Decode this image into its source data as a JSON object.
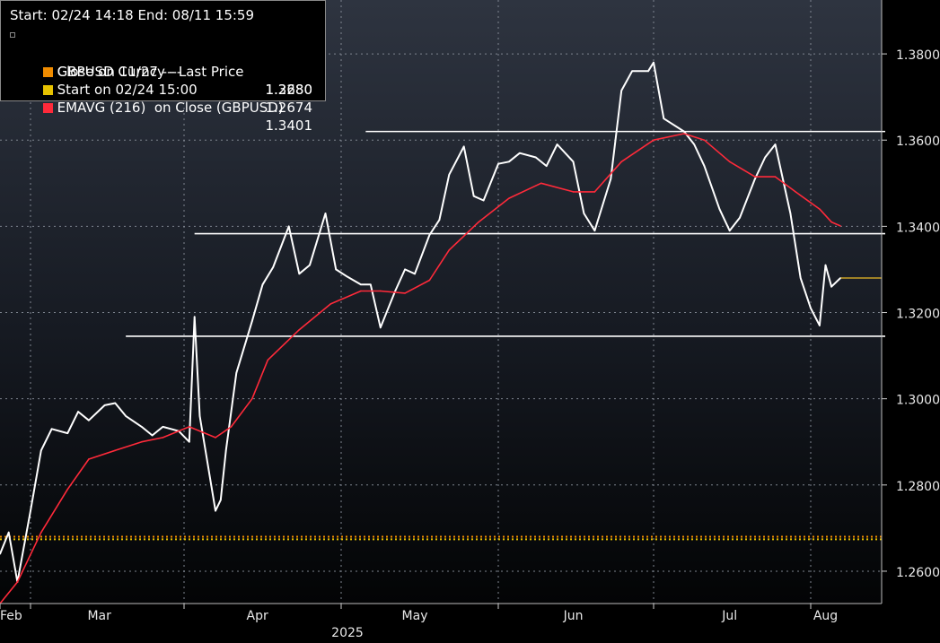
{
  "chart_data": {
    "type": "line",
    "title": "",
    "header": "Start: 02/24 14:18 End: 08/11 15:59",
    "x_axis": {
      "tick_labels": [
        "Feb",
        "Mar",
        "Apr",
        "May",
        "Jun",
        "Jul",
        "Aug"
      ],
      "year_label": "2025",
      "range": [
        "2025-02-24",
        "2025-08-11"
      ]
    },
    "y_axis": {
      "tick_labels": [
        "1.3800",
        "1.3600",
        "1.3400",
        "1.3200",
        "1.3000",
        "1.2800",
        "1.2600"
      ],
      "range": [
        1.2525,
        1.3925
      ],
      "position": "right",
      "grid": true
    },
    "legend": {
      "placement": "top-left",
      "entries": [
        {
          "label": "GBPUSD Curncy - Last Price",
          "value": "1.3280",
          "color": "#ffffff"
        },
        {
          "label": "Close on 11/27 ----",
          "value": "1.2680",
          "color": "#f08c00"
        },
        {
          "label": "Start on 02/24 15:00",
          "value": "1.2674",
          "color": "#e6c200"
        },
        {
          "label": "EMAVG (216)  on Close (GBPUSD)",
          "value": "1.3401",
          "color": "#ff2a3a"
        }
      ]
    },
    "series": [
      {
        "name": "GBPUSD Curncy - Last Price",
        "color": "#ffffff",
        "x": [
          "2025-02-24",
          "2025-02-26",
          "2025-02-28",
          "2025-03-03",
          "2025-03-05",
          "2025-03-07",
          "2025-03-10",
          "2025-03-12",
          "2025-03-14",
          "2025-03-17",
          "2025-03-19",
          "2025-03-21",
          "2025-03-24",
          "2025-03-26",
          "2025-03-28",
          "2025-03-31",
          "2025-04-02",
          "2025-04-03",
          "2025-04-04",
          "2025-04-07",
          "2025-04-08",
          "2025-04-09",
          "2025-04-11",
          "2025-04-14",
          "2025-04-16",
          "2025-04-18",
          "2025-04-21",
          "2025-04-23",
          "2025-04-25",
          "2025-04-28",
          "2025-04-30",
          "2025-05-02",
          "2025-05-05",
          "2025-05-07",
          "2025-05-09",
          "2025-05-12",
          "2025-05-14",
          "2025-05-16",
          "2025-05-19",
          "2025-05-21",
          "2025-05-23",
          "2025-05-26",
          "2025-05-28",
          "2025-05-30",
          "2025-06-02",
          "2025-06-04",
          "2025-06-06",
          "2025-06-09",
          "2025-06-11",
          "2025-06-13",
          "2025-06-16",
          "2025-06-18",
          "2025-06-20",
          "2025-06-23",
          "2025-06-25",
          "2025-06-27",
          "2025-06-30",
          "2025-07-01",
          "2025-07-03",
          "2025-07-07",
          "2025-07-09",
          "2025-07-11",
          "2025-07-14",
          "2025-07-16",
          "2025-07-18",
          "2025-07-21",
          "2025-07-23",
          "2025-07-25",
          "2025-07-28",
          "2025-07-30",
          "2025-08-01",
          "2025-08-04",
          "2025-08-06",
          "2025-08-08",
          "2025-08-11"
        ],
        "values": [
          1.264,
          1.269,
          1.2575,
          1.274,
          1.288,
          1.293,
          1.292,
          1.297,
          1.295,
          1.2985,
          1.299,
          1.296,
          1.2935,
          1.2915,
          1.2935,
          1.2925,
          1.29,
          1.319,
          1.296,
          1.274,
          1.2765,
          1.288,
          1.306,
          1.318,
          1.3265,
          1.3305,
          1.34,
          1.329,
          1.331,
          1.343,
          1.33,
          1.3285,
          1.3265,
          1.3265,
          1.3165,
          1.325,
          1.33,
          1.329,
          1.338,
          1.3415,
          1.352,
          1.3585,
          1.347,
          1.346,
          1.3545,
          1.355,
          1.357,
          1.356,
          1.354,
          1.359,
          1.355,
          1.343,
          1.339,
          1.351,
          1.3715,
          1.376,
          1.376,
          1.378,
          1.365,
          1.362,
          1.359,
          1.354,
          1.344,
          1.339,
          1.342,
          1.351,
          1.356,
          1.359,
          1.343,
          1.328,
          1.321,
          1.317,
          1.331,
          1.326,
          1.328
        ]
      },
      {
        "name": "EMAVG (216)  on Close (GBPUSD)",
        "color": "#ff2a3a",
        "x": [
          "2025-02-24",
          "2025-02-28",
          "2025-03-05",
          "2025-03-10",
          "2025-03-14",
          "2025-03-19",
          "2025-03-24",
          "2025-03-28",
          "2025-04-02",
          "2025-04-07",
          "2025-04-10",
          "2025-04-14",
          "2025-04-17",
          "2025-04-23",
          "2025-04-29",
          "2025-05-05",
          "2025-05-09",
          "2025-05-14",
          "2025-05-19",
          "2025-05-23",
          "2025-05-29",
          "2025-06-04",
          "2025-06-10",
          "2025-06-16",
          "2025-06-20",
          "2025-06-25",
          "2025-07-01",
          "2025-07-07",
          "2025-07-11",
          "2025-07-16",
          "2025-07-21",
          "2025-07-25",
          "2025-07-29",
          "2025-08-04",
          "2025-08-08",
          "2025-08-11"
        ],
        "values": [
          1.2525,
          1.2575,
          1.269,
          1.279,
          1.286,
          1.288,
          1.29,
          1.291,
          1.2935,
          1.291,
          1.2935,
          1.3,
          1.309,
          1.316,
          1.322,
          1.325,
          1.325,
          1.3245,
          1.3275,
          1.3345,
          1.341,
          1.3465,
          1.35,
          1.348,
          1.348,
          1.355,
          1.36,
          1.3615,
          1.36,
          1.355,
          1.3515,
          1.3515,
          1.348,
          1.344,
          1.341,
          1.3401
        ]
      }
    ],
    "reference_lines": [
      {
        "name": "Close on 11/27 ----",
        "value": 1.268,
        "color": "#f08c00",
        "style": "dotted"
      },
      {
        "name": "Start on 02/24 15:00",
        "value": 1.2674,
        "color": "#e6c200",
        "style": "dotted"
      },
      {
        "name": "last-price-marker",
        "value": 1.328,
        "color": "#c9a227",
        "from": "2025-08-11"
      }
    ],
    "annotations": [
      {
        "type": "horizontal-line",
        "value": 1.362,
        "from": "2025-05-06",
        "to": "2025-08-11",
        "color": "#ffffff"
      },
      {
        "type": "horizontal-line",
        "value": 1.3383,
        "from": "2025-04-03",
        "to": "2025-08-11",
        "color": "#ffffff"
      },
      {
        "type": "horizontal-line",
        "value": 1.3145,
        "from": "2025-03-21",
        "to": "2025-08-11",
        "color": "#ffffff"
      }
    ]
  }
}
